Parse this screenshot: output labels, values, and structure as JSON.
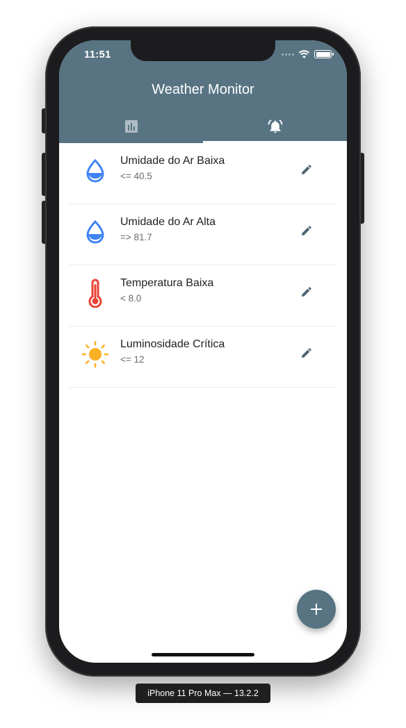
{
  "status_bar": {
    "time": "11:51"
  },
  "app": {
    "title": "Weather Monitor"
  },
  "tabs": [
    {
      "icon": "bar-chart-icon",
      "active": false
    },
    {
      "icon": "alarm-bell-icon",
      "active": true
    }
  ],
  "alerts": [
    {
      "title": "Umidade do Ar Baixa",
      "condition": "<= 40.5",
      "icon": "water-drop-half-icon",
      "color": "#3f82f5"
    },
    {
      "title": "Umidade do Ar Alta",
      "condition": "=> 81.7",
      "icon": "water-drop-half-icon",
      "color": "#3f82f5"
    },
    {
      "title": "Temperatura Baixa",
      "condition": "< 8.0",
      "icon": "thermometer-icon",
      "color": "#ea4335"
    },
    {
      "title": "Luminosidade Crítica",
      "condition": "<= 12",
      "icon": "sun-icon",
      "color": "#fbb024"
    }
  ],
  "fab": {
    "icon": "plus-icon"
  },
  "device_label": "iPhone 11 Pro Max — 13.2.2",
  "colors": {
    "primary": "#587483",
    "drop": "#3f82f5",
    "thermo": "#ea4335",
    "sun": "#fbb024",
    "edit": "#4f6471"
  }
}
